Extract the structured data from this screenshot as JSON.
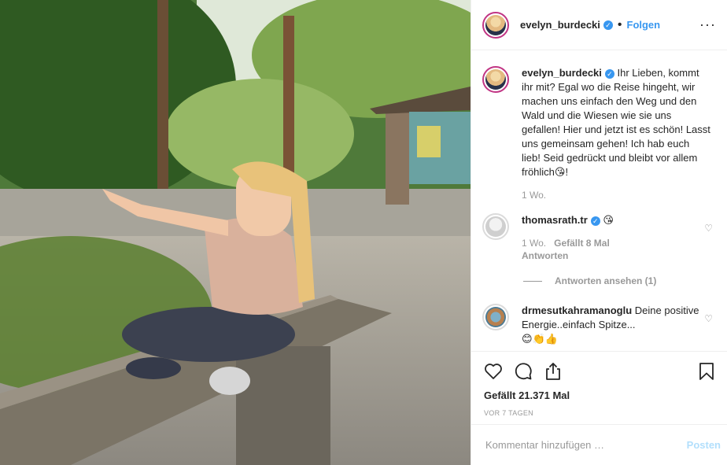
{
  "header": {
    "username": "evelyn_burdecki",
    "follow_label": "Folgen",
    "more_icon": "more-dots-icon"
  },
  "photo": {
    "alt": "Post photo"
  },
  "caption": {
    "username": "evelyn_burdecki",
    "text": "Ihr Lieben, kommt ihr mit? Egal wo die Reise hingeht, wir machen uns einfach den Weg und den Wald und die Wiesen wie sie uns gefallen! Hier und jetzt ist es schön! Lasst uns gemeinsam gehen! Ich hab euch lieb! Seid gedrückt und bleibt vor allem fröhlich",
    "emoji": "😘",
    "end": "!",
    "time": "1 Wo."
  },
  "comments": [
    {
      "username": "thomasrath.tr",
      "text": "😘",
      "time": "1 Wo.",
      "likes": "Gefällt 8 Mal",
      "reply": "Antworten",
      "view_replies": "Antworten ansehen (1)"
    },
    {
      "username": "drmesutkahramanoglu",
      "text": "Deine positive Energie..einfach Spitze...",
      "emoji": "😊👏👍"
    }
  ],
  "footer": {
    "likes": "Gefällt 21.371 Mal",
    "time_ago": "VOR 7 TAGEN",
    "comment_placeholder": "Kommentar hinzufügen …",
    "post_label": "Posten"
  },
  "colors": {
    "link": "#3897f0",
    "post_disabled": "#b2dffc",
    "muted": "#999999"
  }
}
